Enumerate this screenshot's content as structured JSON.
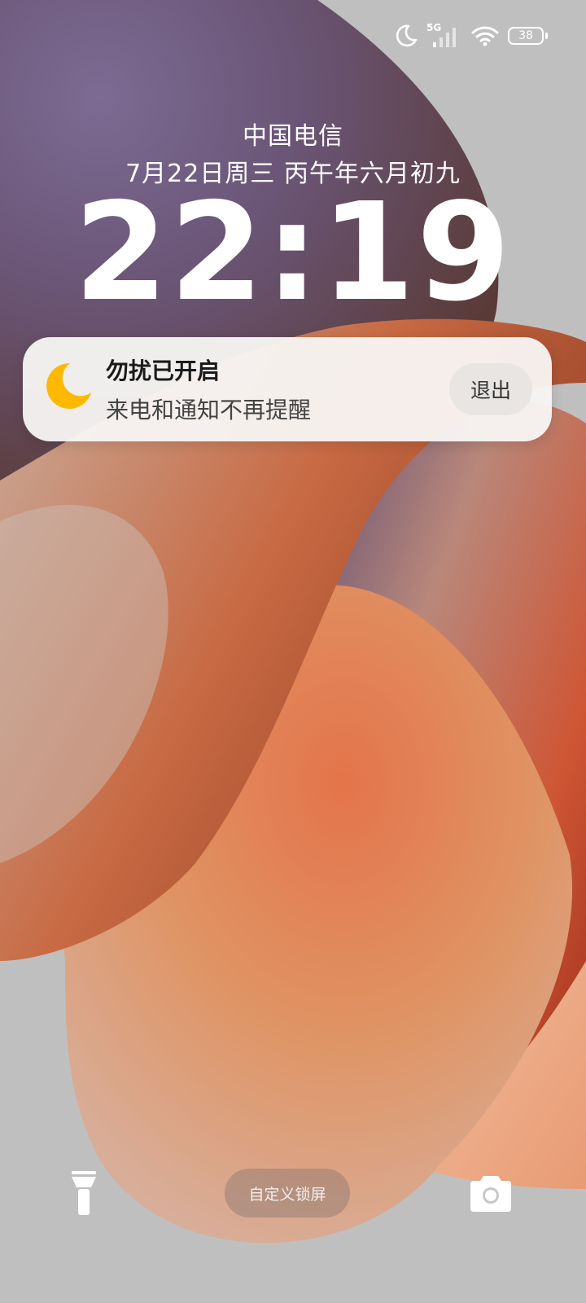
{
  "status_bar": {
    "dnd_icon": "moon-icon",
    "network_label": "5G",
    "signal_icon": "signal-bars-icon",
    "wifi_icon": "wifi-icon",
    "battery_level": "38"
  },
  "lockscreen": {
    "carrier": "中国电信",
    "date": "7月22日周三 丙午年六月初九",
    "time": "22:19"
  },
  "dnd_notification": {
    "icon": "moon-icon",
    "title": "勿扰已开启",
    "subtitle": "来电和通知不再提醒",
    "exit_label": "退出"
  },
  "bottom_bar": {
    "flashlight_icon": "flashlight-icon",
    "customize_label": "自定义锁屏",
    "camera_icon": "camera-icon"
  },
  "colors": {
    "moon_accent": "#FFB800",
    "wallpaper_orange": "#D9734A",
    "wallpaper_purple": "#5E4C78"
  }
}
